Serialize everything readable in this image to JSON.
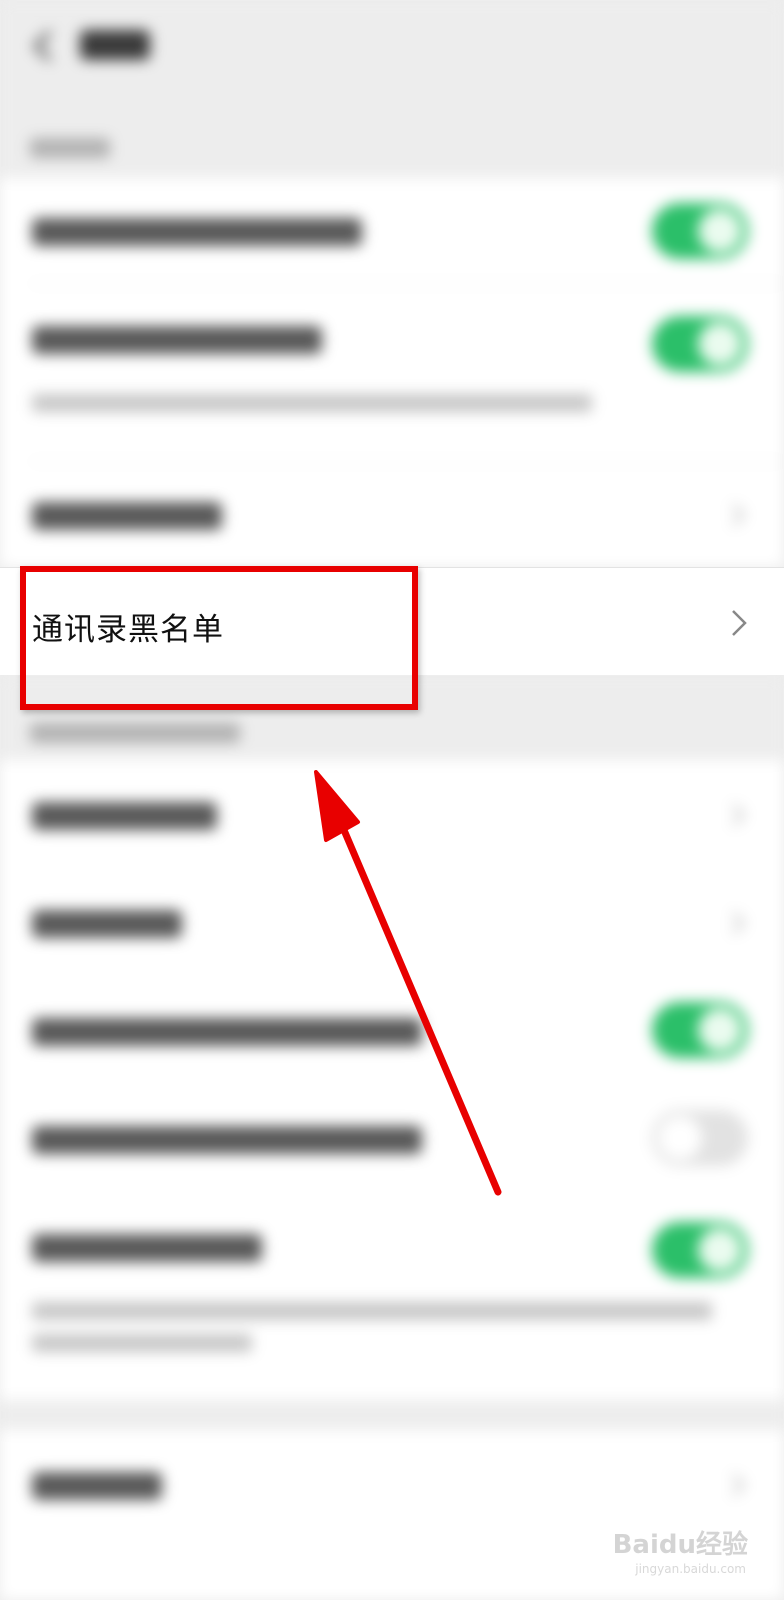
{
  "highlighted_item": {
    "label": "通讯录黑名单"
  },
  "watermark": {
    "brand": "Baidu经验",
    "url": "jingyan.baidu.com"
  },
  "colors": {
    "toggle_on": "#2bbf69",
    "highlight": "#e80000"
  }
}
